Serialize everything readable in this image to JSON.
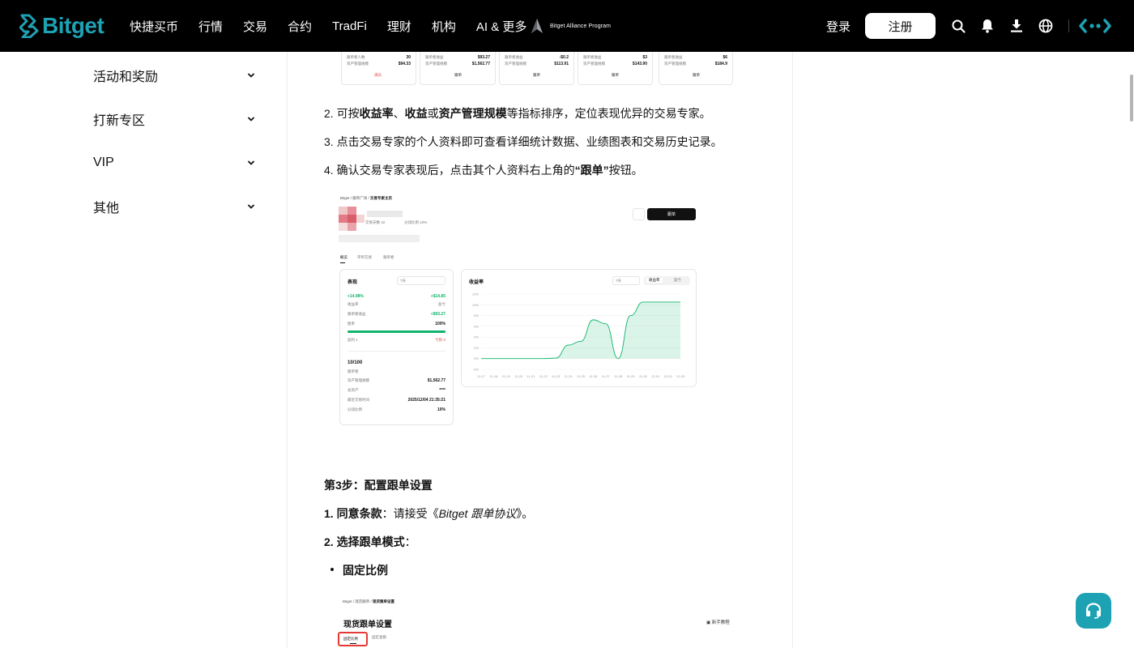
{
  "brand": {
    "name": "Bitget",
    "color": "#1da2b4"
  },
  "nav": {
    "items": [
      "快捷买币",
      "行情",
      "交易",
      "合约",
      "TradFi",
      "理财",
      "机构",
      "AI & 更多"
    ],
    "alliance": "Bitget Alliance Program",
    "login": "登录",
    "register": "注册"
  },
  "icons": [
    "search-icon",
    "bell-icon",
    "download-icon",
    "globe-icon",
    "more-icon",
    "chevron-down-icon",
    "headset-icon"
  ],
  "sidebar": {
    "items": [
      {
        "label": "活动和奖励"
      },
      {
        "label": "打新专区"
      },
      {
        "label": "VIP"
      },
      {
        "label": "其他"
      }
    ]
  },
  "article": {
    "step2": {
      "item2": {
        "num": "2.",
        "pre": "可按",
        "b1": "收益率",
        "sep1": "、",
        "b2": "收益",
        "sep2": "或",
        "b3": "资产管理规模",
        "post": "等指标排序，定位表现优异的交易专家。"
      },
      "item3": {
        "num": "3.",
        "text": "点击交易专家的个人资料即可查看详细统计数据、业绩图表和交易历史记录。"
      },
      "item4": {
        "num": "4.",
        "pre": "确认交易专家表现后，点击其个人资料右上角的",
        "b": "“跟单”",
        "post": "按钮。"
      }
    },
    "step3": {
      "heading": "第3步：配置跟单设置",
      "item1": {
        "label": "1. 同意条款",
        "colon": "：",
        "text": "请接受《",
        "italic": "Bitget 跟单协议",
        "end": "》。"
      },
      "item2": {
        "label": "2. 选择跟单模式",
        "colon": "："
      },
      "bullet1": "固定比例"
    }
  },
  "top_cards": [
    {
      "r1l": "跟单者人数",
      "r1v": "30",
      "r2l": "资产管理规模",
      "r2v": "$94.33",
      "btn": "满员"
    },
    {
      "r1l": "跟单者收益",
      "r1v": "$93.27",
      "r2l": "资产管理规模",
      "r2v": "$1,562.77",
      "btn": "跟单"
    },
    {
      "r1l": "跟单者收益",
      "r1v": "-$0.2",
      "r2l": "资产管理规模",
      "r2v": "$113.91",
      "btn": "跟单"
    },
    {
      "r1l": "跟单者收益",
      "r1v": "$3",
      "r2l": "资产管理规模",
      "r2v": "$143.90",
      "btn": "跟单"
    },
    {
      "r1l": "跟单者收益",
      "r1v": "$6",
      "r2l": "资产管理规模",
      "r2v": "$184.9",
      "btn": "跟单"
    }
  ],
  "profile_shot": {
    "breadcrumb": [
      "Bitget",
      "跟单广场",
      "交易专家主页"
    ],
    "stats": [
      "交易天数 42",
      "分润比例 10%"
    ],
    "follow_btn": "跟单",
    "tabs": [
      "概览",
      "带单交易",
      "跟单者"
    ],
    "perf": {
      "title": "表现",
      "period": "7天",
      "roi": "+14.98%",
      "roi_label": "收益率",
      "pnl": "+$14.85",
      "pnl_label": "盈亏",
      "follower_pnl_label": "跟单者收益",
      "follower_pnl": "+$93.27",
      "winrate_label": "胜率",
      "winrate": "100%",
      "win_fraction": 1.0,
      "profit_label": "盈利 1",
      "loss_label": "亏损 0",
      "score": "10/100",
      "score_label": "跟单者",
      "rows": [
        {
          "label": "资产管理规模",
          "value": "$1,562.77"
        },
        {
          "label": "总资产",
          "value": "****"
        },
        {
          "label": "最近交易时间",
          "value": "2025/12/04 21:35:21"
        },
        {
          "label": "分润比例",
          "value": "10%"
        }
      ]
    },
    "roi_chart": {
      "title": "收益率",
      "period": "7天",
      "toggle": [
        "收益率",
        "盈亏"
      ],
      "yticks": [
        "12%",
        "10%",
        "8%",
        "6%",
        "4%",
        "2%",
        "0%",
        "-2%"
      ],
      "xticks": [
        "11-17",
        "11-18",
        "11-19",
        "11-20",
        "11-21",
        "11-22",
        "11-23",
        "11-24",
        "11-25",
        "11-26",
        "11-27",
        "11-28",
        "11-29",
        "11-30",
        "12-01",
        "12-02",
        "12-03"
      ]
    }
  },
  "chart_data": {
    "type": "area",
    "title": "收益率",
    "ylim": [
      -2,
      12
    ],
    "x": [
      "11-17",
      "11-18",
      "11-19",
      "11-20",
      "11-21",
      "11-22",
      "11-23",
      "11-24",
      "11-25",
      "11-26",
      "11-27",
      "11-28",
      "11-29",
      "11-30",
      "12-01",
      "12-02",
      "12-03"
    ],
    "series": [
      {
        "values": [
          0,
          0,
          0,
          0,
          0,
          0,
          0.1,
          2.5,
          3.2,
          7.2,
          6.5,
          0.0,
          8.0,
          10.5,
          10.5,
          10.5,
          10.5
        ]
      }
    ],
    "color": "#10b36b"
  },
  "settings_shot": {
    "breadcrumb": [
      "Bitget",
      "现货跟单",
      "现货跟单设置"
    ],
    "title": "现货跟单设置",
    "guide": "新手教程",
    "tabs": [
      "固定比例",
      "固定金额"
    ]
  }
}
